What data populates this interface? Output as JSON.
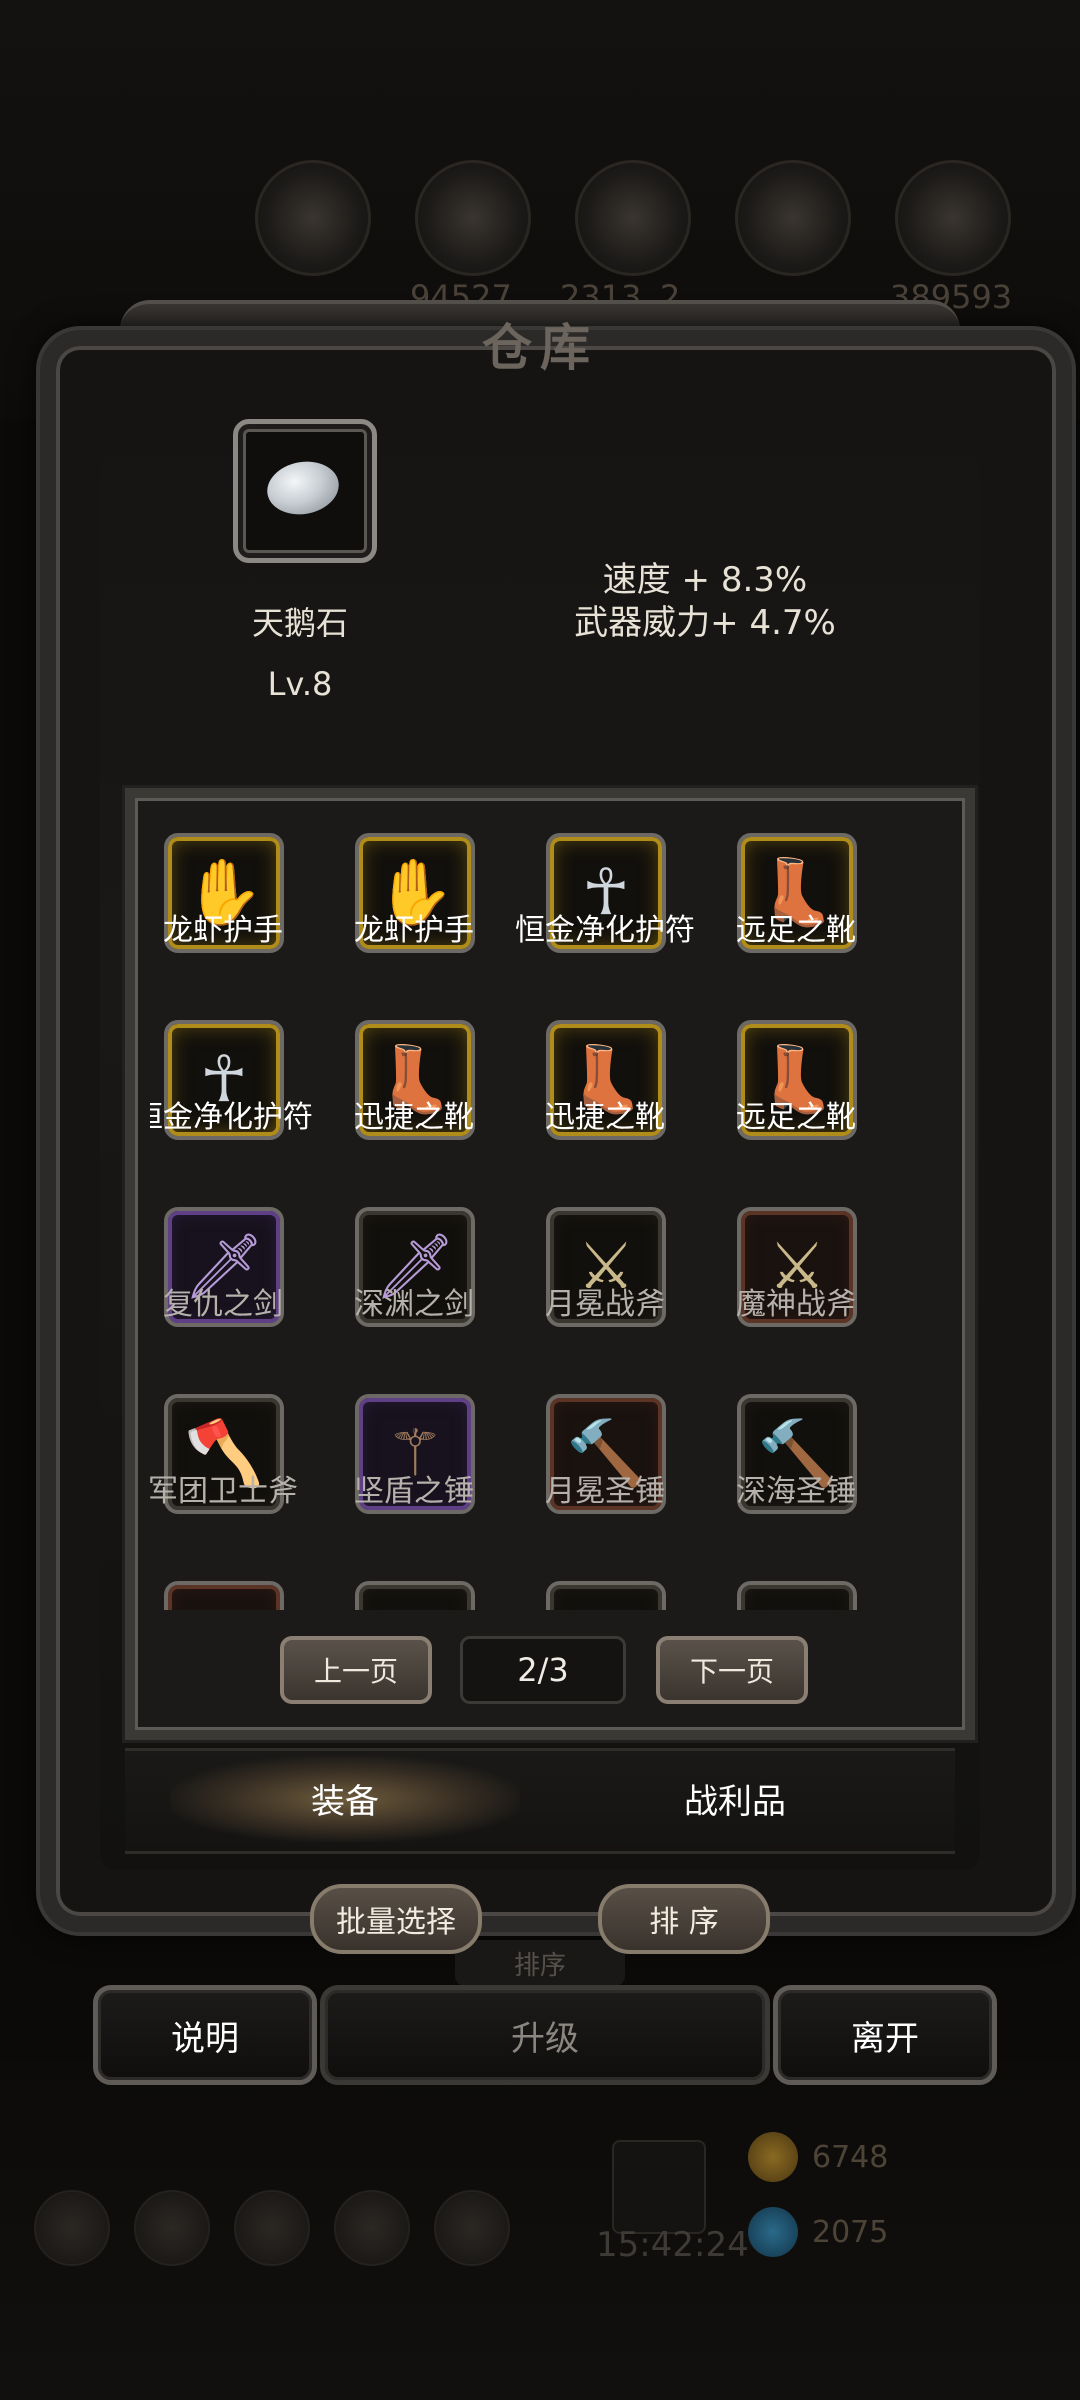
{
  "background": {
    "stat_numbers": [
      "94527",
      "2313",
      "2",
      "389593"
    ],
    "resources": [
      {
        "value": "6748",
        "icon": "gold-coin-icon"
      },
      {
        "value": "2075",
        "icon": "blue-gem-icon"
      }
    ],
    "clock": "15:42:24"
  },
  "dialog": {
    "title": "仓库"
  },
  "selected_item": {
    "icon": "swan-stone-icon",
    "name": "天鹅石",
    "level": "Lv.8",
    "stats": [
      "速度 + 8.3%",
      "武器威力+ 4.7%"
    ]
  },
  "inventory": {
    "items": [
      {
        "name": "龙虾护手",
        "icon": "gauntlet-icon",
        "rarity": "gold"
      },
      {
        "name": "龙虾护手",
        "icon": "gauntlet-icon",
        "rarity": "gold"
      },
      {
        "name": "恒金净化护符",
        "icon": "amulet-icon",
        "rarity": "gold"
      },
      {
        "name": "远足之靴",
        "icon": "boots-icon",
        "rarity": "gold"
      },
      {
        "name": "恒金净化护符",
        "icon": "amulet-icon",
        "rarity": "gold"
      },
      {
        "name": "迅捷之靴",
        "icon": "boots-icon",
        "rarity": "gold"
      },
      {
        "name": "迅捷之靴",
        "icon": "boots-icon",
        "rarity": "gold"
      },
      {
        "name": "远足之靴",
        "icon": "boots-icon",
        "rarity": "gold"
      },
      {
        "name": "复仇之剑",
        "icon": "sword-icon",
        "rarity": "purple"
      },
      {
        "name": "深渊之剑",
        "icon": "sword-icon",
        "rarity": "dark"
      },
      {
        "name": "月冕战斧",
        "icon": "battle-axe-icon",
        "rarity": "dark"
      },
      {
        "name": "魔神战斧",
        "icon": "battle-axe-icon",
        "rarity": "red"
      },
      {
        "name": "军团卫士斧",
        "icon": "axe-icon",
        "rarity": "dark"
      },
      {
        "name": "坚盾之锤",
        "icon": "mace-icon",
        "rarity": "purple"
      },
      {
        "name": "月冕圣锤",
        "icon": "hammer-icon",
        "rarity": "red"
      },
      {
        "name": "深海圣锤",
        "icon": "hammer-icon",
        "rarity": "dark"
      },
      {
        "name": "",
        "icon": "item-icon",
        "rarity": "red"
      },
      {
        "name": "",
        "icon": "item-icon",
        "rarity": "dark"
      },
      {
        "name": "",
        "icon": "item-icon",
        "rarity": "dark"
      },
      {
        "name": "",
        "icon": "item-icon",
        "rarity": "dark"
      }
    ],
    "prev_label": "上一页",
    "next_label": "下一页",
    "page": "2/3"
  },
  "tabs": {
    "equipment": "装备",
    "loot": "战利品"
  },
  "actions": {
    "batch_select": "批量选择",
    "sort": "排 序",
    "sort_ghost": "排序",
    "help": "说明",
    "upgrade": "升级",
    "leave": "离开"
  },
  "colors": {
    "rarity_gold": "#b08c1a",
    "rarity_purple": "#5f3f86",
    "frame": "#3b3936",
    "button_border": "#877b6c"
  }
}
